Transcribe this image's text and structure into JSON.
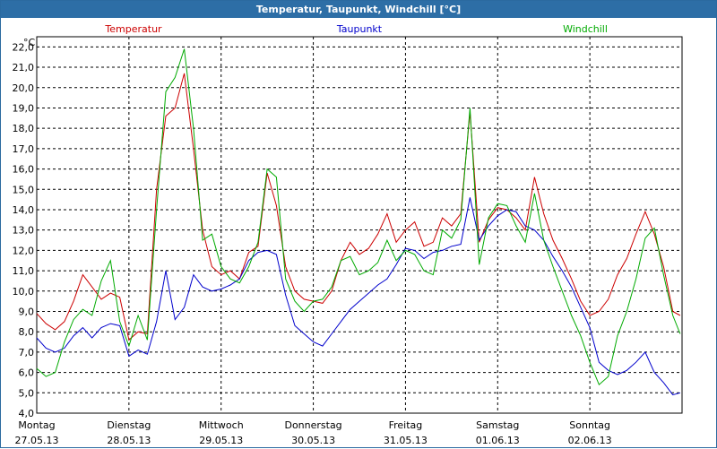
{
  "window_title": "Temperatur, Taupunkt, Windchill [°C]",
  "colors": {
    "temperatur": "#cc0000",
    "taupunkt": "#0000cc",
    "windchill": "#00aa00",
    "titlebar": "#2d6ea6"
  },
  "chart_data": {
    "type": "line",
    "title": "Temperatur, Taupunkt, Windchill [°C]",
    "ylabel": "°C",
    "ylim": [
      4.0,
      22.5
    ],
    "xlim": [
      0,
      7.0
    ],
    "grid": true,
    "y_ticks": [
      "4,0",
      "5,0",
      "6,0",
      "7,0",
      "8,0",
      "9,0",
      "10,0",
      "11,0",
      "12,0",
      "13,0",
      "14,0",
      "15,0",
      "16,0",
      "17,0",
      "18,0",
      "19,0",
      "20,0",
      "21,0",
      "22,0"
    ],
    "x_ticks": [
      {
        "day": "Montag",
        "date": "27.05.13"
      },
      {
        "day": "Dienstag",
        "date": "28.05.13"
      },
      {
        "day": "Mittwoch",
        "date": "29.05.13"
      },
      {
        "day": "Donnerstag",
        "date": "30.05.13"
      },
      {
        "day": "Freitag",
        "date": "31.05.13"
      },
      {
        "day": "Samstag",
        "date": "01.06.13"
      },
      {
        "day": "Sonntag",
        "date": "02.06.13"
      }
    ],
    "series": [
      {
        "name": "Temperatur",
        "color": "#cc0000",
        "x": [
          0,
          0.1,
          0.2,
          0.3,
          0.4,
          0.5,
          0.6,
          0.7,
          0.8,
          0.9,
          1.0,
          1.1,
          1.2,
          1.3,
          1.4,
          1.5,
          1.6,
          1.7,
          1.8,
          1.9,
          2.0,
          2.1,
          2.2,
          2.3,
          2.4,
          2.5,
          2.6,
          2.7,
          2.8,
          2.9,
          3.0,
          3.1,
          3.2,
          3.3,
          3.4,
          3.5,
          3.6,
          3.7,
          3.8,
          3.9,
          4.0,
          4.1,
          4.2,
          4.3,
          4.4,
          4.5,
          4.6,
          4.7,
          4.8,
          4.9,
          5.0,
          5.1,
          5.2,
          5.3,
          5.4,
          5.5,
          5.6,
          5.7,
          5.8,
          5.9,
          6.0,
          6.1,
          6.2,
          6.3,
          6.4,
          6.5,
          6.6,
          6.7,
          6.8,
          6.9,
          6.98
        ],
        "values": [
          8.9,
          8.4,
          8.1,
          8.5,
          9.5,
          10.8,
          10.2,
          9.6,
          9.9,
          9.7,
          7.6,
          8.0,
          7.9,
          15.0,
          18.6,
          19.0,
          20.7,
          17.0,
          13.0,
          11.2,
          10.8,
          11.0,
          10.6,
          11.9,
          12.2,
          15.8,
          14.2,
          11.2,
          10.0,
          9.6,
          9.5,
          9.4,
          10.0,
          11.5,
          12.4,
          11.8,
          12.1,
          12.8,
          13.8,
          12.4,
          13.0,
          13.4,
          12.2,
          12.4,
          13.6,
          13.2,
          13.8,
          18.8,
          12.4,
          13.5,
          14.1,
          14.0,
          13.6,
          13.0,
          15.6,
          13.8,
          12.5,
          11.6,
          10.6,
          9.5,
          8.8,
          9.0,
          9.6,
          10.8,
          11.6,
          12.8,
          13.9,
          12.8,
          11.2,
          9.0,
          8.8
        ]
      },
      {
        "name": "Taupunkt",
        "color": "#0000cc",
        "x": [
          0,
          0.1,
          0.2,
          0.3,
          0.4,
          0.5,
          0.6,
          0.7,
          0.8,
          0.9,
          1.0,
          1.1,
          1.2,
          1.3,
          1.4,
          1.5,
          1.6,
          1.7,
          1.8,
          1.9,
          2.0,
          2.1,
          2.2,
          2.3,
          2.4,
          2.5,
          2.6,
          2.7,
          2.8,
          2.9,
          3.0,
          3.1,
          3.2,
          3.3,
          3.4,
          3.5,
          3.6,
          3.7,
          3.8,
          3.9,
          4.0,
          4.1,
          4.2,
          4.3,
          4.4,
          4.5,
          4.6,
          4.7,
          4.8,
          4.9,
          5.0,
          5.1,
          5.2,
          5.3,
          5.4,
          5.5,
          5.6,
          5.7,
          5.8,
          5.9,
          6.0,
          6.1,
          6.2,
          6.3,
          6.4,
          6.5,
          6.6,
          6.7,
          6.8,
          6.9,
          6.98
        ],
        "values": [
          7.7,
          7.2,
          7.0,
          7.2,
          7.8,
          8.2,
          7.7,
          8.2,
          8.4,
          8.3,
          6.8,
          7.1,
          6.9,
          8.5,
          11.0,
          8.6,
          9.2,
          10.8,
          10.2,
          10.0,
          10.1,
          10.3,
          10.6,
          11.5,
          11.9,
          12.0,
          11.8,
          9.8,
          8.3,
          7.9,
          7.5,
          7.3,
          7.9,
          8.5,
          9.1,
          9.5,
          9.9,
          10.3,
          10.6,
          11.3,
          12.1,
          12.0,
          11.6,
          11.9,
          12.0,
          12.2,
          12.3,
          14.6,
          12.5,
          13.2,
          13.7,
          14.0,
          13.9,
          13.2,
          13.0,
          12.5,
          11.7,
          11.0,
          10.2,
          9.2,
          8.2,
          6.5,
          6.1,
          5.9,
          6.1,
          6.5,
          7.0,
          6.0,
          5.5,
          4.9,
          5.0
        ]
      },
      {
        "name": "Windchill",
        "color": "#00aa00",
        "x": [
          0,
          0.1,
          0.2,
          0.3,
          0.4,
          0.5,
          0.6,
          0.7,
          0.8,
          0.9,
          1.0,
          1.1,
          1.2,
          1.3,
          1.4,
          1.5,
          1.6,
          1.7,
          1.8,
          1.9,
          2.0,
          2.1,
          2.2,
          2.3,
          2.4,
          2.5,
          2.6,
          2.7,
          2.8,
          2.9,
          3.0,
          3.1,
          3.2,
          3.3,
          3.4,
          3.5,
          3.6,
          3.7,
          3.8,
          3.9,
          4.0,
          4.1,
          4.2,
          4.3,
          4.4,
          4.5,
          4.6,
          4.7,
          4.8,
          4.9,
          5.0,
          5.1,
          5.2,
          5.3,
          5.4,
          5.5,
          5.6,
          5.7,
          5.8,
          5.9,
          6.0,
          6.1,
          6.2,
          6.3,
          6.4,
          6.5,
          6.6,
          6.7,
          6.8,
          6.9,
          6.98
        ],
        "values": [
          6.2,
          5.8,
          6.0,
          7.5,
          8.6,
          9.1,
          8.8,
          10.5,
          11.5,
          8.5,
          7.3,
          8.8,
          7.6,
          14.0,
          19.8,
          20.5,
          21.9,
          18.0,
          12.5,
          12.8,
          11.2,
          10.6,
          10.4,
          11.2,
          12.4,
          16.0,
          15.6,
          10.6,
          9.5,
          9.0,
          9.5,
          9.6,
          10.2,
          11.5,
          11.7,
          10.8,
          11.0,
          11.4,
          12.5,
          11.5,
          12.0,
          11.8,
          11.0,
          10.8,
          13.0,
          12.6,
          13.5,
          19.0,
          11.3,
          13.6,
          14.3,
          14.2,
          13.2,
          12.4,
          14.8,
          12.5,
          11.2,
          10.0,
          8.8,
          7.8,
          6.5,
          5.4,
          5.8,
          7.8,
          9.0,
          10.6,
          12.6,
          13.1,
          10.8,
          8.8,
          7.9
        ]
      }
    ]
  }
}
